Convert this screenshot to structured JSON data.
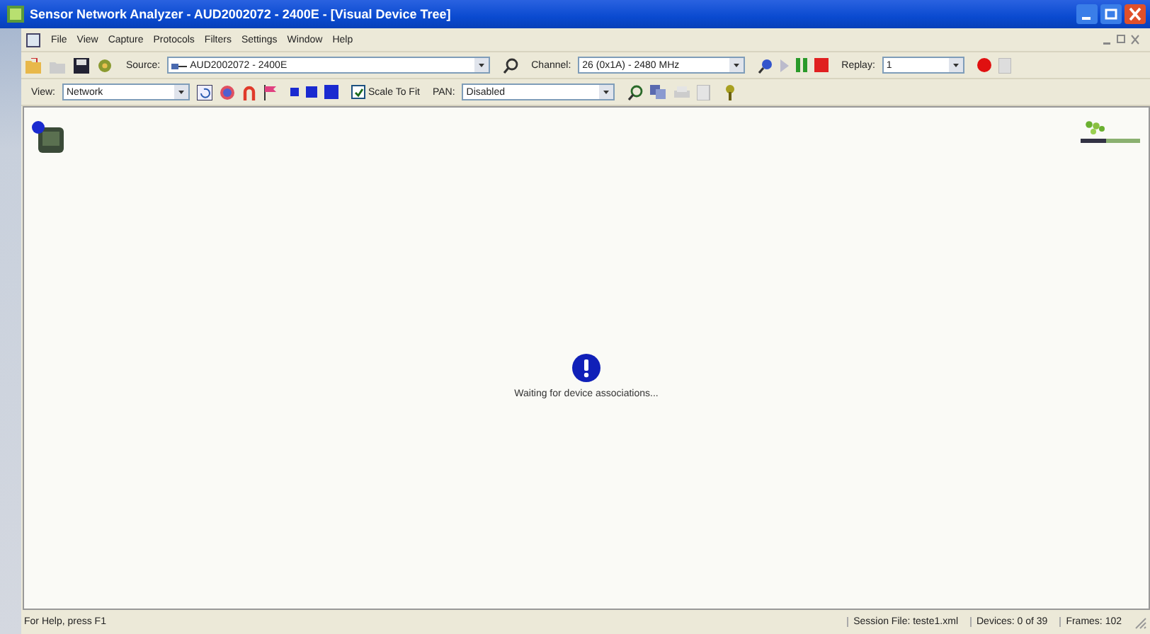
{
  "window": {
    "title": "Sensor Network Analyzer - AUD2002072 - 2400E - [Visual Device Tree]"
  },
  "menu": [
    "File",
    "View",
    "Capture",
    "Protocols",
    "Filters",
    "Settings",
    "Window",
    "Help"
  ],
  "toolbar": {
    "source_label": "Source:",
    "source": "AUD2002072 - 2400E",
    "channel_label": "Channel:",
    "channel": "26 (0x1A) - 2480 MHz",
    "replay_label": "Replay:",
    "replay": "1"
  },
  "view_bar": {
    "view_label": "View:",
    "view": "Network",
    "scale_to_fit": {
      "label": "Scale To Fit",
      "checked": true
    },
    "pan_label": "PAN:",
    "pan": "Disabled"
  },
  "canvas": {
    "message": "Waiting for device associations..."
  },
  "status_bar": {
    "help": "For Help, press F1",
    "session": "Session File: teste1.xml",
    "devices": "Devices: 0 of 39",
    "frames": "Frames: 102"
  }
}
